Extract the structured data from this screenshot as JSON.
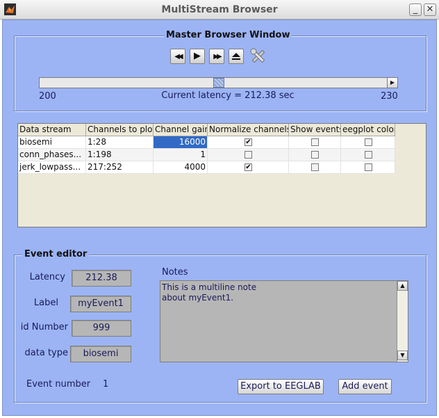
{
  "window": {
    "title": "MultiStream Browser",
    "minimize_glyph": "_",
    "close_glyph": "✕",
    "app_icon": "matlab-icon"
  },
  "master": {
    "title": "Master Browser Window",
    "toolbar": [
      {
        "name": "rewind-icon",
        "glyph": "◀◀"
      },
      {
        "name": "play-icon",
        "glyph": "▶"
      },
      {
        "name": "fast-forward-icon",
        "glyph": "▶▶"
      },
      {
        "name": "eject-icon",
        "glyph": "▲"
      },
      {
        "name": "settings-tools-icon",
        "glyph": "⚒"
      }
    ],
    "slider": {
      "min_label": "200",
      "max_label": "230",
      "value": 212.38,
      "min": 200,
      "max": 230
    },
    "latency_text": "Current latency = 212.38 sec"
  },
  "table": {
    "headers": [
      "Data stream",
      "Channels to plot",
      "Channel gain",
      "Normalize channels",
      "Show events",
      "eegplot color"
    ],
    "rows": [
      {
        "stream": "biosemi",
        "channels": "1:28",
        "gain": "16000",
        "normalize": true,
        "show_events": false,
        "color": false,
        "gain_selected": true
      },
      {
        "stream": "conn_phases...",
        "channels": "1:198",
        "gain": "1",
        "normalize": false,
        "show_events": false,
        "color": false,
        "gain_selected": false
      },
      {
        "stream": "jerk_lowpass...",
        "channels": "217:252",
        "gain": "4000",
        "normalize": true,
        "show_events": false,
        "color": false,
        "gain_selected": false
      }
    ]
  },
  "event_editor": {
    "title": "Event editor",
    "latency_label": "Latency",
    "latency_value": "212.38",
    "label_label": "Label",
    "label_value": "myEvent1",
    "id_label": "id Number",
    "id_value": "999",
    "type_label": "data type",
    "type_value": "biosemi",
    "notes_label": "Notes",
    "notes_line1": "This is a multiline note",
    "notes_line2": "about myEvent1.",
    "event_number_label": "Event number",
    "event_number_value": "1",
    "export_label": "Export to EEGLAB",
    "add_label": "Add event"
  },
  "colors": {
    "client_bg": "#9cb4f4",
    "selection": "#316ac5",
    "text": "#1a1a5a"
  }
}
